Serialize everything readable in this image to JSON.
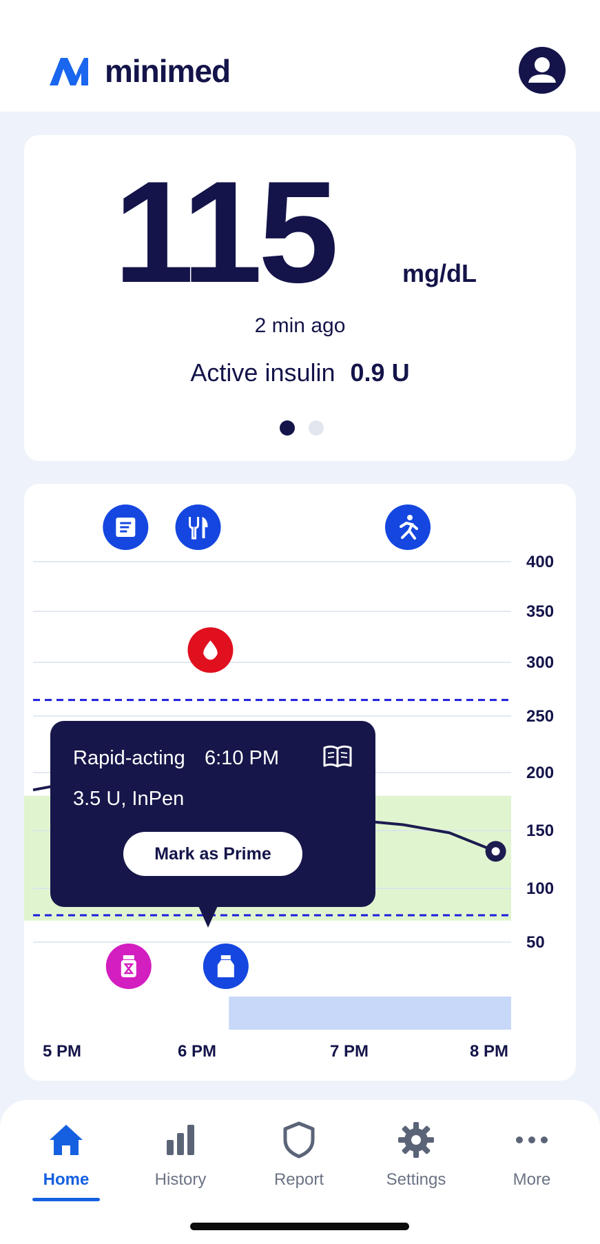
{
  "header": {
    "brand": "minimed",
    "logo_icon": "minimed-logo-icon",
    "avatar_icon": "user-avatar-icon"
  },
  "glucose": {
    "value": "115",
    "unit": "mg/dL",
    "time": "2 min ago",
    "active_insulin_label": "Active insulin",
    "active_insulin_value": "0.9 U",
    "page_index": 1,
    "page_count": 2
  },
  "chart_data": {
    "type": "line",
    "x_ticks": [
      "5 PM",
      "6 PM",
      "7 PM",
      "8 PM"
    ],
    "y_ticks": [
      "400",
      "350",
      "300",
      "250",
      "200",
      "150",
      "100",
      "50"
    ],
    "ylim": [
      50,
      400
    ],
    "grid": true,
    "target_range": [
      70,
      180
    ],
    "threshold_high": 265,
    "threshold_low": 75,
    "series": [
      {
        "points": [
          [
            16.9,
            185
          ],
          [
            17.3,
            195
          ],
          [
            18.5,
            165
          ],
          [
            18.9,
            160
          ],
          [
            19.3,
            155
          ],
          [
            19.6,
            148
          ],
          [
            19.9,
            132
          ]
        ]
      }
    ],
    "event_markers": [
      {
        "icon": "note-icon",
        "time": 17.5,
        "color": "#1547e0"
      },
      {
        "icon": "meal-icon",
        "time": 17.97,
        "color": "#1547e0"
      },
      {
        "icon": "exercise-icon",
        "time": 19.33,
        "color": "#1547e0"
      },
      {
        "icon": "blood-drop-icon",
        "time": 18.05,
        "value": 312,
        "color": "#e0101f"
      },
      {
        "icon": "long-acting-pen-icon",
        "time": 17.52,
        "color": "#d31ec0"
      },
      {
        "icon": "rapid-acting-pen-icon",
        "time": 18.15,
        "color": "#1547e0"
      }
    ],
    "basal_bar": {
      "start": 18.17,
      "end": 20.0,
      "color": "#c7d8f8"
    }
  },
  "tooltip": {
    "insulin_type": "Rapid-acting",
    "time": "6:10 PM",
    "dose": "3.5 U, InPen",
    "book_icon": "logbook-icon",
    "button_label": "Mark as Prime"
  },
  "colors": {
    "navy": "#14144a",
    "accent": "#1560e0",
    "range_fill": "#e0f5cf",
    "threshold": "#1d1ddc"
  },
  "nav": {
    "items": [
      {
        "label": "Home",
        "icon": "home-icon",
        "active": true
      },
      {
        "label": "History",
        "icon": "bar-chart-icon",
        "active": false
      },
      {
        "label": "Report",
        "icon": "shield-icon",
        "active": false
      },
      {
        "label": "Settings",
        "icon": "gear-icon",
        "active": false
      },
      {
        "label": "More",
        "icon": "more-dots-icon",
        "active": false
      }
    ]
  }
}
